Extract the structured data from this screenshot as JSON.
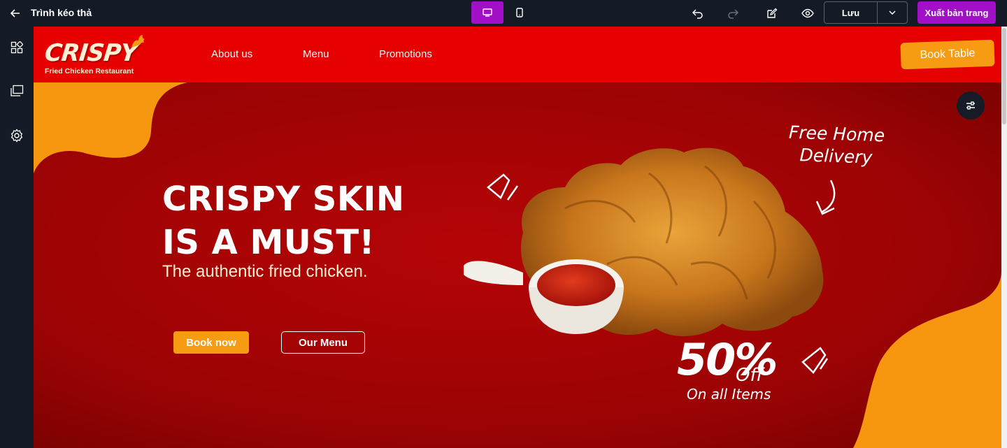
{
  "editor": {
    "title": "Trình kéo thả",
    "save_label": "Lưu",
    "publish_label": "Xuất bản trang",
    "accent": "#a10fc7",
    "background": "#141a26"
  },
  "site": {
    "logo_text": "CRISPY",
    "logo_subtitle": "Fried Chicken Restaurant",
    "nav": [
      "About us",
      "Menu",
      "Promotions"
    ],
    "book_table_label": "Book Table",
    "header_color": "#e60000",
    "accent_orange": "#f79b12"
  },
  "hero": {
    "headline_line1": "CRISPY SKIN",
    "headline_line2": "IS A MUST!",
    "tagline": "The authentic fried chicken.",
    "book_now_label": "Book now",
    "our_menu_label": "Our Menu",
    "free_delivery": "Free Home Delivery",
    "promo_percent": "50%",
    "promo_off": "Off",
    "promo_items": "On all Items"
  }
}
